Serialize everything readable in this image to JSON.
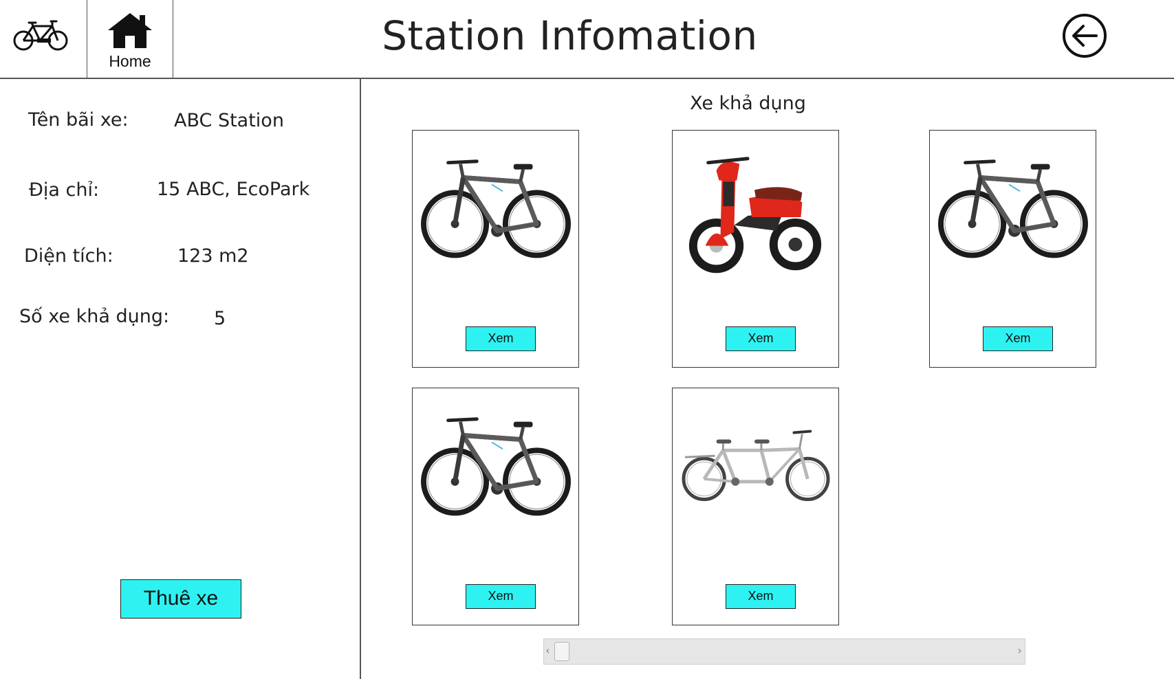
{
  "header": {
    "logo_icon": "bicycle-icon",
    "home_icon": "home-icon",
    "home_label": "Home",
    "title": "Station Infomation",
    "back_icon": "arrow-left-circle-icon"
  },
  "station": {
    "name_label": "Tên bãi xe:",
    "name_value": "ABC Station",
    "address_label": "Địa chỉ:",
    "address_value": "15 ABC, EcoPark",
    "area_label": "Diện tích:",
    "area_value": "123 m2",
    "available_label": "Số xe khả dụng:",
    "available_value": "5",
    "rent_button": "Thuê xe"
  },
  "available": {
    "title": "Xe khả dụng",
    "vehicles": [
      {
        "type": "mountain-bike",
        "button": "Xem"
      },
      {
        "type": "electric-scooter",
        "button": "Xem"
      },
      {
        "type": "mountain-bike",
        "button": "Xem"
      },
      {
        "type": "mountain-bike",
        "button": "Xem"
      },
      {
        "type": "tandem-bike",
        "button": "Xem"
      }
    ]
  },
  "scrollbar": {
    "left_arrow": "‹",
    "right_arrow": "›"
  },
  "colors": {
    "accent": "#2ef2f2",
    "border": "#555555"
  }
}
